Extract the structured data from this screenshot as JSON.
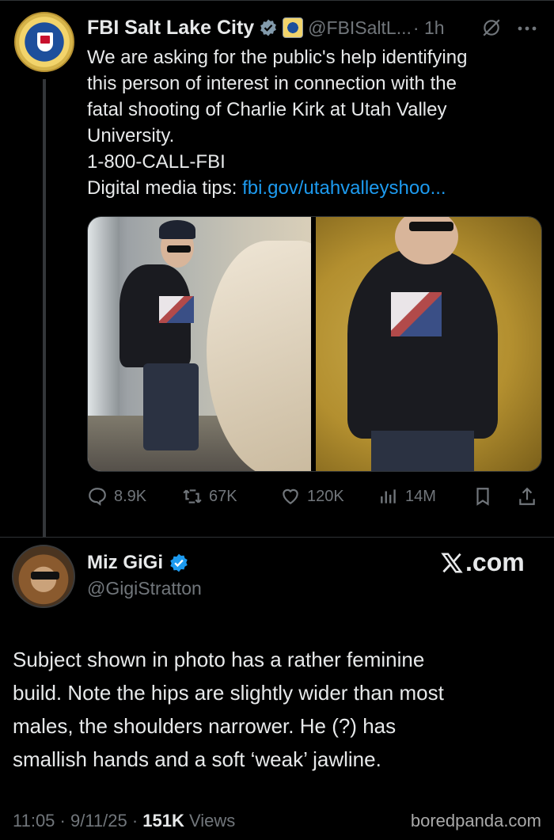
{
  "tweet": {
    "author_name": "FBI Salt Lake City",
    "handle": "@FBISaltL...",
    "time": "· 1h",
    "lines": [
      "We are asking for the public's help identifying",
      "this person of interest in connection with the",
      "fatal shooting of Charlie Kirk at Utah Valley",
      "University.",
      "1-800-CALL-FBI"
    ],
    "tips_label": "Digital media tips: ",
    "tips_link": "fbi.gov/utahvalleyshoo...",
    "stats": {
      "replies": "8.9K",
      "reposts": "67K",
      "likes": "120K",
      "views": "14M"
    }
  },
  "reply": {
    "author_name": "Miz GiGi",
    "handle": "@GigiStratton",
    "brand": ".com",
    "lines": [
      "Subject shown in photo has a rather feminine",
      "build. Note the hips are slightly wider than most",
      "males, the shoulders narrower. He (?) has",
      "smallish hands and a soft ‘weak’ jawline."
    ],
    "timestamp": "11:05 · 9/11/25 · ",
    "views_count": "151K",
    "views_label": " Views"
  },
  "watermark": "boredpanda.com",
  "colors": {
    "background": "#000000",
    "text": "#e7e9ea",
    "secondary": "#71767b",
    "link": "#1d9bf0",
    "verified_blue": "#1d9bf0"
  },
  "icons": [
    "verified-gray-badge",
    "fbi-seal-badge",
    "grok-icon",
    "more-icon",
    "reply-icon",
    "repost-icon",
    "like-icon",
    "views-icon",
    "bookmark-icon",
    "share-icon",
    "verified-blue-badge",
    "x-logo"
  ]
}
